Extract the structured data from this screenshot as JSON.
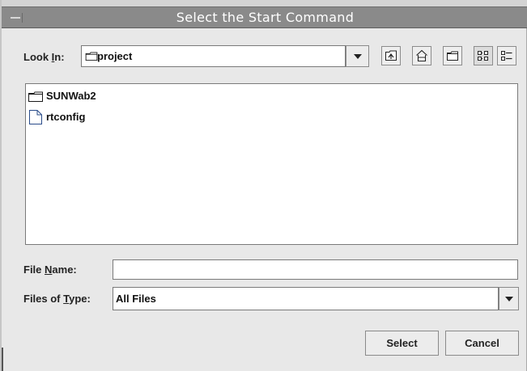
{
  "window": {
    "title": "Select the Start Command"
  },
  "look_in": {
    "label_pre": "Look ",
    "label_mnemonic": "I",
    "label_post": "n:",
    "value": "project",
    "icon": "folder-icon"
  },
  "toolbar": {
    "up_icon": "up-folder-icon",
    "home_icon": "home-icon",
    "new_folder_icon": "new-folder-icon",
    "list_view_icon": "list-view-icon",
    "details_view_icon": "details-view-icon"
  },
  "files": [
    {
      "name": "SUNWab2",
      "icon": "folder-icon"
    },
    {
      "name": "rtconfig",
      "icon": "file-icon"
    }
  ],
  "file_name": {
    "label_pre": "File ",
    "label_mnemonic": "N",
    "label_post": "ame:",
    "value": ""
  },
  "file_type": {
    "label_pre": "Files of ",
    "label_mnemonic": "T",
    "label_post": "ype:",
    "value": "All Files"
  },
  "buttons": {
    "select": "Select",
    "cancel": "Cancel"
  }
}
